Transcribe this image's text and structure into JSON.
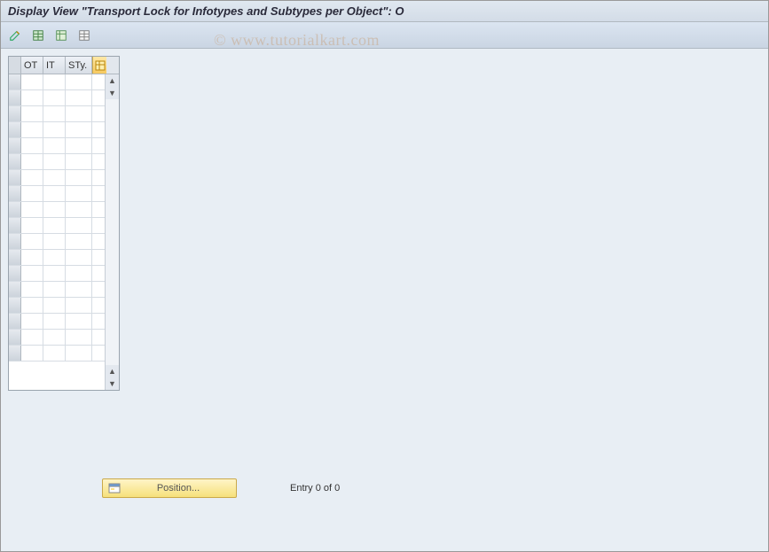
{
  "title": "Display View \"Transport Lock for Infotypes and Subtypes per Object\": O",
  "watermark": "© www.tutorialkart.com",
  "toolbar": {
    "icons": [
      "change-icon",
      "select-all-icon",
      "deselect-all-icon",
      "table-settings-icon"
    ]
  },
  "table": {
    "columns": [
      {
        "key": "ot",
        "label": "OT"
      },
      {
        "key": "it",
        "label": "IT"
      },
      {
        "key": "sty",
        "label": "STy."
      }
    ],
    "rows": [
      {},
      {},
      {},
      {},
      {},
      {},
      {},
      {},
      {},
      {},
      {},
      {},
      {},
      {},
      {},
      {},
      {},
      {}
    ],
    "config_tooltip": "Configure"
  },
  "footer": {
    "position_label": "Position...",
    "entry_text": "Entry 0 of 0"
  }
}
